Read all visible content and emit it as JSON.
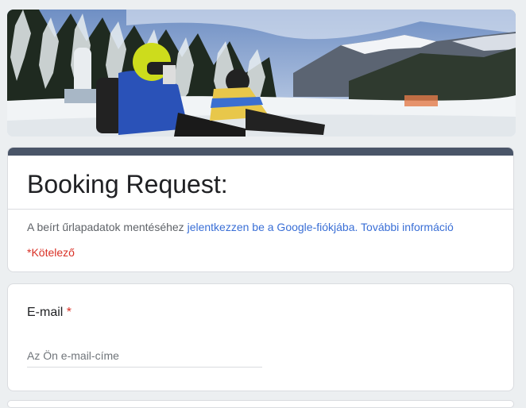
{
  "header_image": {
    "description_icon": "snowboarders-on-slope-image"
  },
  "form": {
    "title": "Booking Request:",
    "signin_prefix": "A beírt űrlapadatok mentéséhez ",
    "signin_link": "jelentkezzen be a Google-fiókjába.",
    "more_info_link": "További információ",
    "required_note": "*Kötelező"
  },
  "questions": [
    {
      "label": "E-mail",
      "required_marker": "*",
      "placeholder": "Az Ön e-mail-címe",
      "value": ""
    }
  ],
  "colors": {
    "accent_bar": "#4a5568",
    "link": "#3a6fd6",
    "required": "#d93025",
    "background": "#eceff1"
  }
}
